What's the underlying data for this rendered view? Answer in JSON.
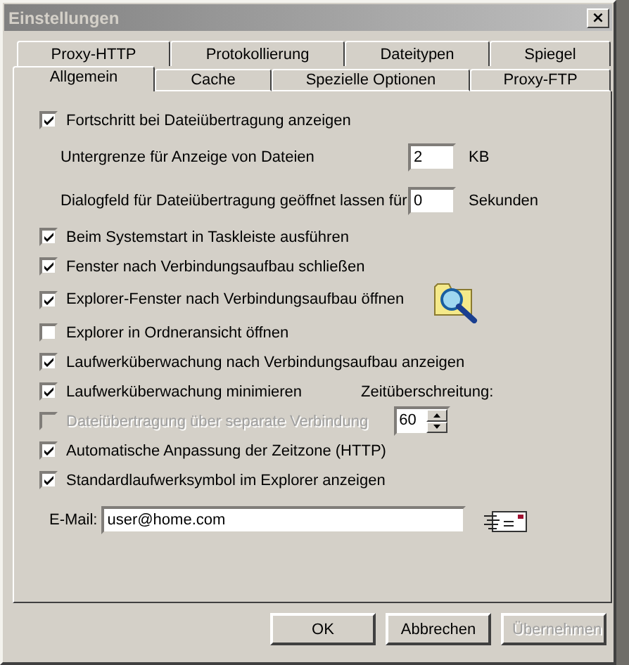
{
  "window": {
    "title": "Einstellungen",
    "close": "×"
  },
  "tab_rows": [
    [
      {
        "label": "Proxy-HTTP",
        "selected": false
      },
      {
        "label": "Protokollierung",
        "selected": false
      },
      {
        "label": "Dateitypen",
        "selected": false
      },
      {
        "label": "Spiegel",
        "selected": false
      }
    ],
    [
      {
        "label": "Allgemein",
        "selected": true
      },
      {
        "label": "Cache",
        "selected": false
      },
      {
        "label": "Spezielle Optionen",
        "selected": false
      },
      {
        "label": "Proxy-FTP",
        "selected": false
      }
    ]
  ],
  "rows": [
    {
      "kind": "checkbox",
      "label": "Fortschritt bei Dateiübertragung anzeigen",
      "checked": true,
      "disabled": false
    },
    {
      "kind": "field",
      "label": "Untergrenze für Anzeige von Dateien",
      "value": "2",
      "unit": "KB"
    },
    {
      "kind": "field",
      "label": "Dialogfeld für Dateiübertragung geöffnet lassen für",
      "value": "0",
      "unit": "Sekunden"
    },
    {
      "kind": "checkbox",
      "label": "Beim Systemstart in Taskleiste ausführen",
      "checked": true,
      "disabled": false
    },
    {
      "kind": "checkbox",
      "label": "Fenster nach Verbindungsaufbau schließen",
      "checked": true,
      "disabled": false
    },
    {
      "kind": "checkbox",
      "label": "Explorer-Fenster nach Verbindungsaufbau öffnen",
      "checked": true,
      "disabled": false
    },
    {
      "kind": "checkbox",
      "label": "Explorer in Ordneransicht öffnen",
      "checked": false,
      "disabled": false
    },
    {
      "kind": "checkbox",
      "label": "Laufwerküberwachung nach Verbindungsaufbau anzeigen",
      "checked": true,
      "disabled": false
    },
    {
      "kind": "checkbox",
      "label": "Laufwerküberwachung minimieren",
      "checked": true,
      "disabled": false,
      "note": "Zeitüberschreitung:"
    },
    {
      "kind": "checkbox",
      "label": "Dateiübertragung über separate Verbindung",
      "checked": false,
      "disabled": true,
      "spinner": "60"
    },
    {
      "kind": "checkbox",
      "label": "Automatische Anpassung der Zeitzone (HTTP)",
      "checked": true,
      "disabled": false
    },
    {
      "kind": "checkbox",
      "label": "Standardlaufwerksymbol im Explorer anzeigen",
      "checked": true,
      "disabled": false
    },
    {
      "kind": "email",
      "label": "E-Mail:",
      "value": "user@home.com"
    }
  ],
  "buttons": [
    {
      "label": "OK",
      "disabled": false
    },
    {
      "label": "Abbrechen",
      "disabled": false
    },
    {
      "label": "Übernehmen",
      "disabled": true
    }
  ]
}
